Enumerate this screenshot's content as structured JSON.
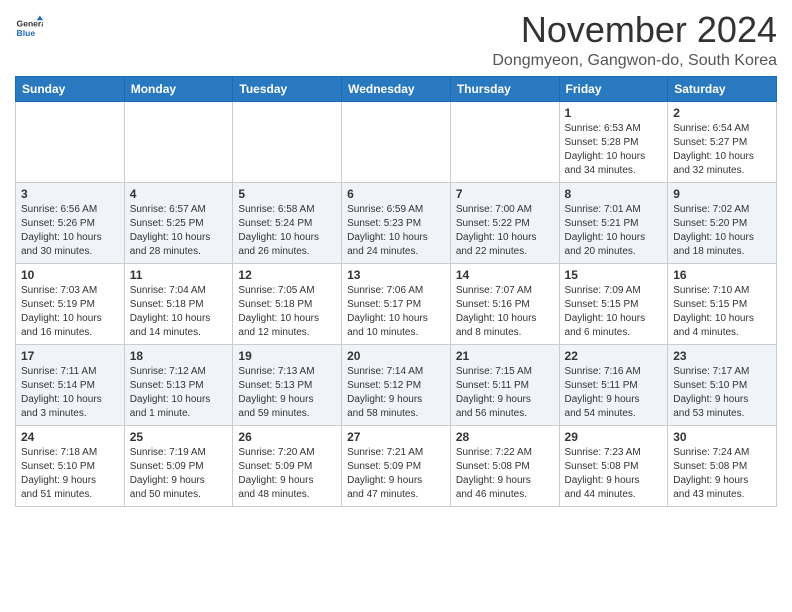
{
  "header": {
    "logo_line1": "General",
    "logo_line2": "Blue",
    "month_title": "November 2024",
    "location": "Dongmyeon, Gangwon-do, South Korea"
  },
  "weekdays": [
    "Sunday",
    "Monday",
    "Tuesday",
    "Wednesday",
    "Thursday",
    "Friday",
    "Saturday"
  ],
  "weeks": [
    [
      {
        "day": "",
        "info": ""
      },
      {
        "day": "",
        "info": ""
      },
      {
        "day": "",
        "info": ""
      },
      {
        "day": "",
        "info": ""
      },
      {
        "day": "",
        "info": ""
      },
      {
        "day": "1",
        "info": "Sunrise: 6:53 AM\nSunset: 5:28 PM\nDaylight: 10 hours\nand 34 minutes."
      },
      {
        "day": "2",
        "info": "Sunrise: 6:54 AM\nSunset: 5:27 PM\nDaylight: 10 hours\nand 32 minutes."
      }
    ],
    [
      {
        "day": "3",
        "info": "Sunrise: 6:56 AM\nSunset: 5:26 PM\nDaylight: 10 hours\nand 30 minutes."
      },
      {
        "day": "4",
        "info": "Sunrise: 6:57 AM\nSunset: 5:25 PM\nDaylight: 10 hours\nand 28 minutes."
      },
      {
        "day": "5",
        "info": "Sunrise: 6:58 AM\nSunset: 5:24 PM\nDaylight: 10 hours\nand 26 minutes."
      },
      {
        "day": "6",
        "info": "Sunrise: 6:59 AM\nSunset: 5:23 PM\nDaylight: 10 hours\nand 24 minutes."
      },
      {
        "day": "7",
        "info": "Sunrise: 7:00 AM\nSunset: 5:22 PM\nDaylight: 10 hours\nand 22 minutes."
      },
      {
        "day": "8",
        "info": "Sunrise: 7:01 AM\nSunset: 5:21 PM\nDaylight: 10 hours\nand 20 minutes."
      },
      {
        "day": "9",
        "info": "Sunrise: 7:02 AM\nSunset: 5:20 PM\nDaylight: 10 hours\nand 18 minutes."
      }
    ],
    [
      {
        "day": "10",
        "info": "Sunrise: 7:03 AM\nSunset: 5:19 PM\nDaylight: 10 hours\nand 16 minutes."
      },
      {
        "day": "11",
        "info": "Sunrise: 7:04 AM\nSunset: 5:18 PM\nDaylight: 10 hours\nand 14 minutes."
      },
      {
        "day": "12",
        "info": "Sunrise: 7:05 AM\nSunset: 5:18 PM\nDaylight: 10 hours\nand 12 minutes."
      },
      {
        "day": "13",
        "info": "Sunrise: 7:06 AM\nSunset: 5:17 PM\nDaylight: 10 hours\nand 10 minutes."
      },
      {
        "day": "14",
        "info": "Sunrise: 7:07 AM\nSunset: 5:16 PM\nDaylight: 10 hours\nand 8 minutes."
      },
      {
        "day": "15",
        "info": "Sunrise: 7:09 AM\nSunset: 5:15 PM\nDaylight: 10 hours\nand 6 minutes."
      },
      {
        "day": "16",
        "info": "Sunrise: 7:10 AM\nSunset: 5:15 PM\nDaylight: 10 hours\nand 4 minutes."
      }
    ],
    [
      {
        "day": "17",
        "info": "Sunrise: 7:11 AM\nSunset: 5:14 PM\nDaylight: 10 hours\nand 3 minutes."
      },
      {
        "day": "18",
        "info": "Sunrise: 7:12 AM\nSunset: 5:13 PM\nDaylight: 10 hours\nand 1 minute."
      },
      {
        "day": "19",
        "info": "Sunrise: 7:13 AM\nSunset: 5:13 PM\nDaylight: 9 hours\nand 59 minutes."
      },
      {
        "day": "20",
        "info": "Sunrise: 7:14 AM\nSunset: 5:12 PM\nDaylight: 9 hours\nand 58 minutes."
      },
      {
        "day": "21",
        "info": "Sunrise: 7:15 AM\nSunset: 5:11 PM\nDaylight: 9 hours\nand 56 minutes."
      },
      {
        "day": "22",
        "info": "Sunrise: 7:16 AM\nSunset: 5:11 PM\nDaylight: 9 hours\nand 54 minutes."
      },
      {
        "day": "23",
        "info": "Sunrise: 7:17 AM\nSunset: 5:10 PM\nDaylight: 9 hours\nand 53 minutes."
      }
    ],
    [
      {
        "day": "24",
        "info": "Sunrise: 7:18 AM\nSunset: 5:10 PM\nDaylight: 9 hours\nand 51 minutes."
      },
      {
        "day": "25",
        "info": "Sunrise: 7:19 AM\nSunset: 5:09 PM\nDaylight: 9 hours\nand 50 minutes."
      },
      {
        "day": "26",
        "info": "Sunrise: 7:20 AM\nSunset: 5:09 PM\nDaylight: 9 hours\nand 48 minutes."
      },
      {
        "day": "27",
        "info": "Sunrise: 7:21 AM\nSunset: 5:09 PM\nDaylight: 9 hours\nand 47 minutes."
      },
      {
        "day": "28",
        "info": "Sunrise: 7:22 AM\nSunset: 5:08 PM\nDaylight: 9 hours\nand 46 minutes."
      },
      {
        "day": "29",
        "info": "Sunrise: 7:23 AM\nSunset: 5:08 PM\nDaylight: 9 hours\nand 44 minutes."
      },
      {
        "day": "30",
        "info": "Sunrise: 7:24 AM\nSunset: 5:08 PM\nDaylight: 9 hours\nand 43 minutes."
      }
    ]
  ]
}
